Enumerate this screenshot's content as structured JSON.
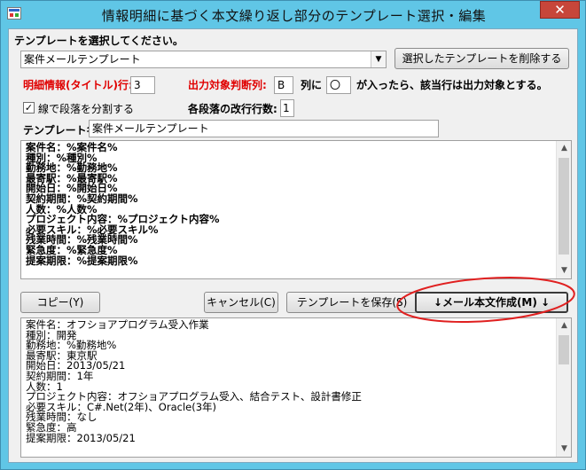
{
  "window": {
    "title": "情報明細に基づく本文繰り返し部分のテンプレート選択・編集",
    "close_glyph": "✕"
  },
  "select_section": {
    "label": "テンプレートを選択してください。",
    "template_combo_value": "案件メールテンプレート",
    "delete_button": "選択したテンプレートを削除する"
  },
  "settings": {
    "title_row_label": "明細情報(タイトル)行:",
    "title_row_value": "3",
    "output_col_label": "出力対象判断列:",
    "output_col_value": "B",
    "col_suffix": "列に",
    "mark_value": "〇",
    "mark_suffix": "が入ったら、該当行は出力対象とする。",
    "split_checkbox_checked": true,
    "split_checkbox_glyph": "✓",
    "split_checkbox_label": "線で段落を分割する",
    "line_feed_label": "各段落の改行行数:",
    "line_feed_value": "1",
    "template_name_label": "テンプレート名:",
    "template_name_value": "案件メールテンプレート"
  },
  "template_body": {
    "lines": [
      "案件名：%案件名%",
      "種別：%種別%",
      "勤務地：%勤務地%",
      "最寄駅：%最寄駅%",
      "開始日：%開始日%",
      "契約期間：%契約期間%",
      "人数：%人数%",
      "プロジェクト内容：%プロジェクト内容%",
      "必要スキル：%必要スキル%",
      "残業時間：%残業時間%",
      "緊急度：%緊急度%",
      "提案期限：%提案期限%"
    ]
  },
  "buttons": {
    "copy": "コピー(Y)",
    "cancel": "キャンセル(C)",
    "save_template": "テンプレートを保存(S)",
    "create_mail_body": "↓メール本文作成(M) ↓"
  },
  "preview_body": {
    "lines": [
      "案件名：オフショアプログラム受入作業",
      "種別：開発",
      "勤務地：%勤務地%",
      "最寄駅：東京駅",
      "開始日：2013/05/21",
      "契約期間：1年",
      "人数：1",
      "プロジェクト内容：オフショアプログラム受入、結合テスト、設計書修正",
      "必要スキル：C#.Net(2年)、Oracle(3年)",
      "残業時間：なし",
      "緊急度：高",
      "提案期限：2013/05/21"
    ]
  },
  "colors": {
    "title_bar": "#60c6e6",
    "close_button": "#c7463a",
    "highlight_ellipse": "#e02020",
    "required_label": "#e00000"
  },
  "scrollbar_glyphs": {
    "up": "▲",
    "down": "▼"
  },
  "combo_arrow_glyph": "▼"
}
